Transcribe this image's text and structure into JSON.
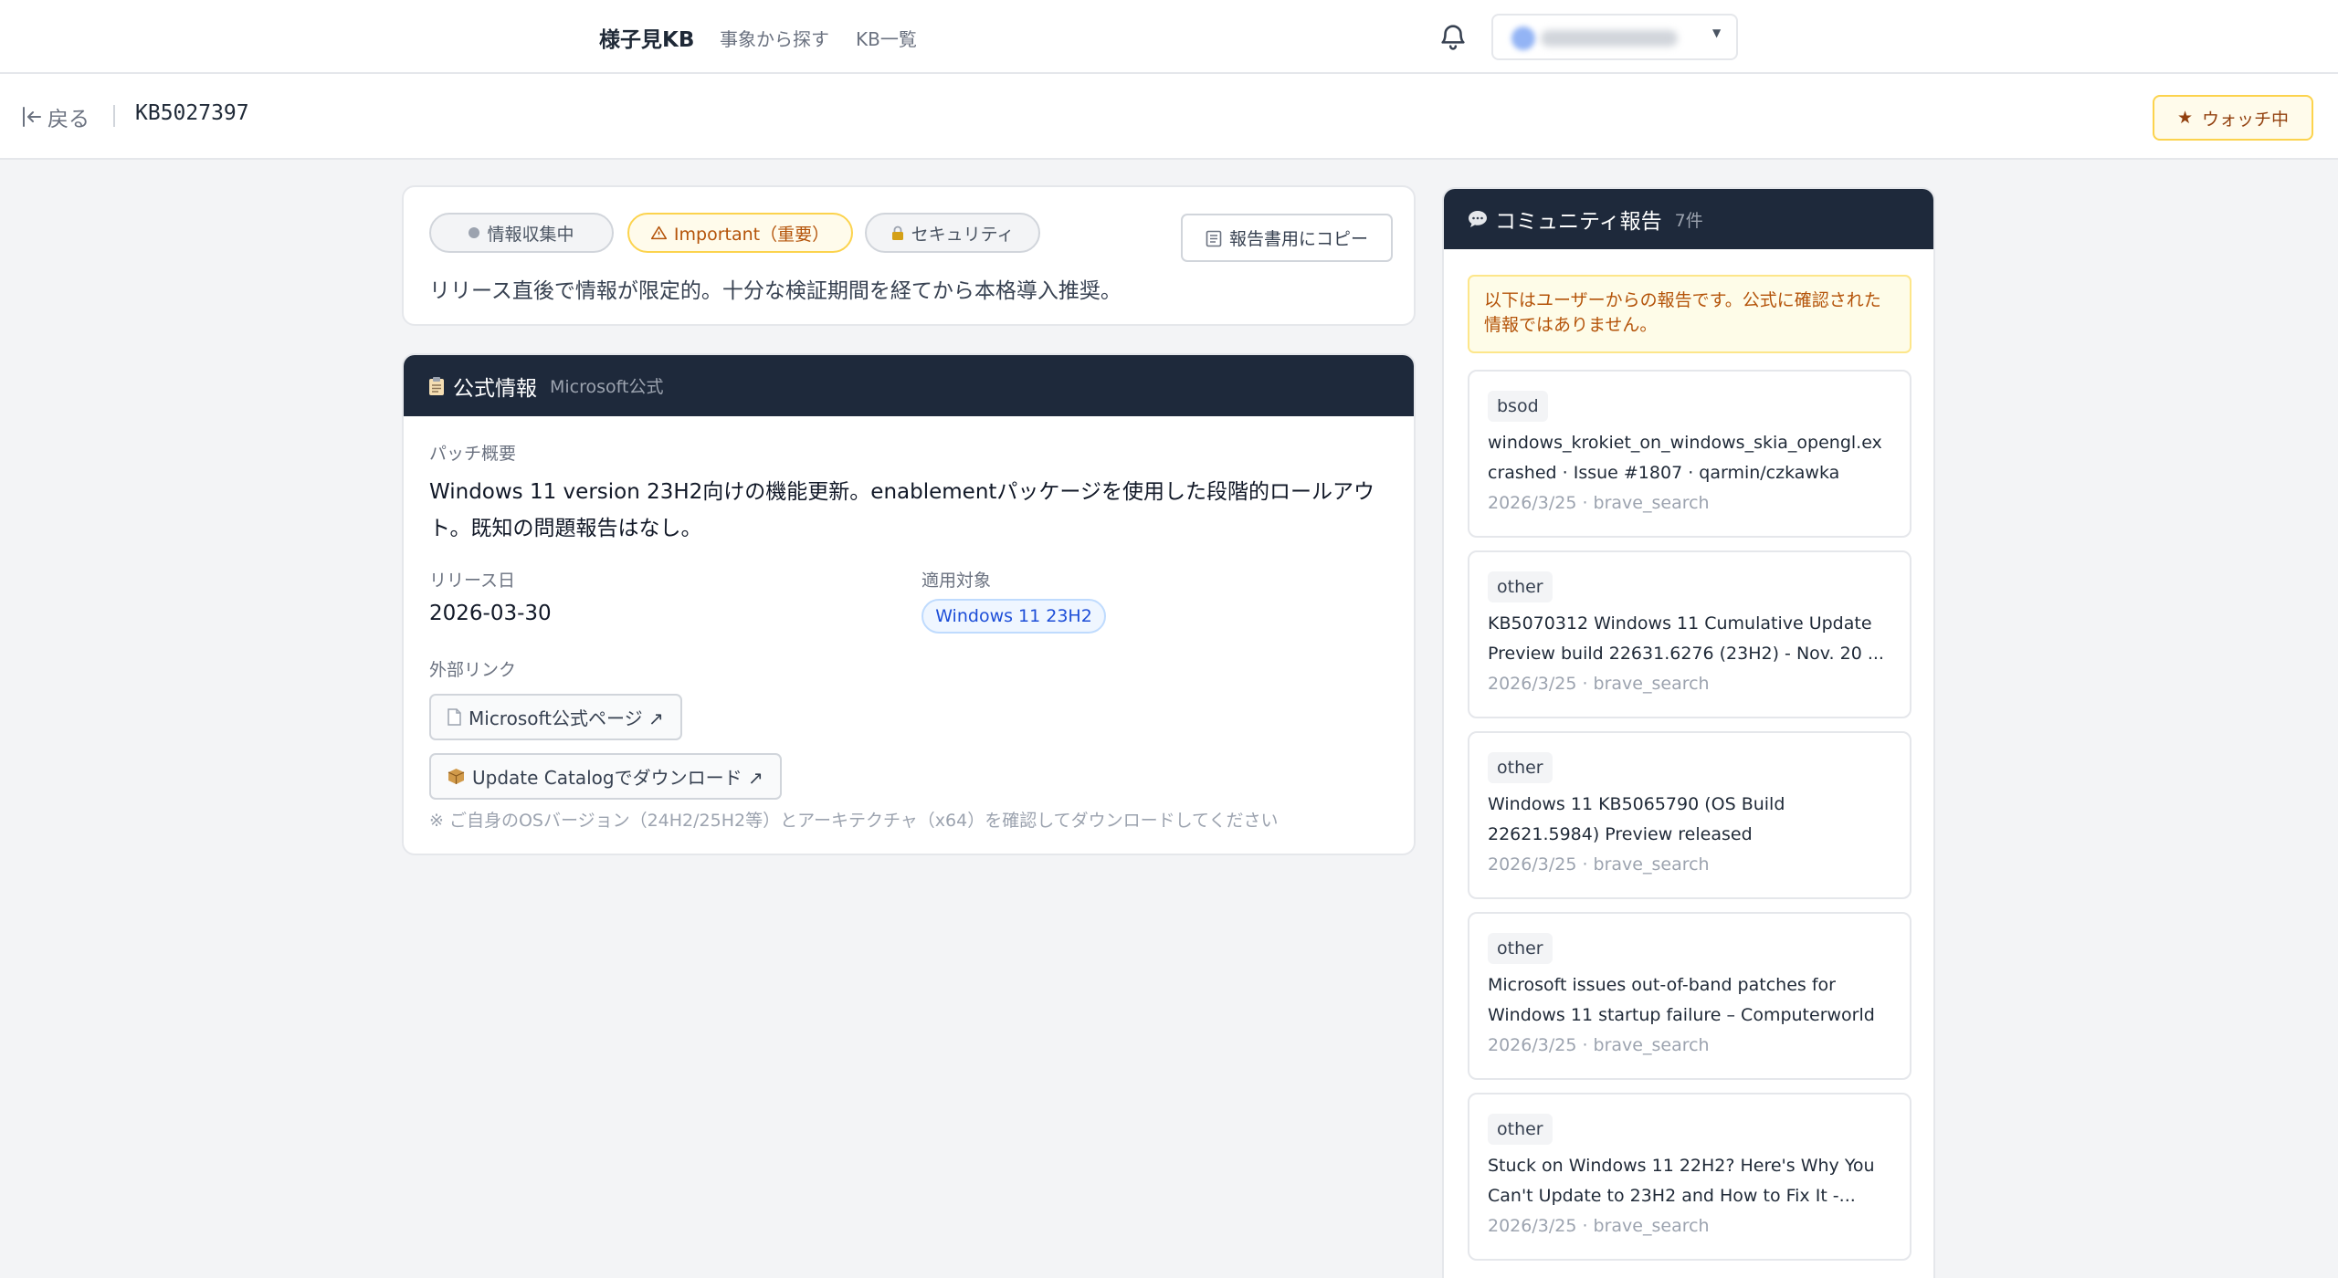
{
  "nav": {
    "brand": "様子見KB",
    "links": [
      "事象から探す",
      "KB一覧"
    ]
  },
  "subheader": {
    "back_label": "戻る",
    "kb_id": "KB5027397",
    "watch_label": "ウォッチ中"
  },
  "status": {
    "pills": [
      "情報収集中",
      "Important（重要）",
      "セキュリティ"
    ],
    "copy_label": "報告書用にコピー",
    "note": "リリース直後で情報が限定的。十分な検証期間を経てから本格導入推奨。"
  },
  "official": {
    "title": "公式情報",
    "subtitle": "Microsoft公式",
    "summary_label": "パッチ概要",
    "summary": "Windows 11 version 23H2向けの機能更新。enablementパッケージを使用した段階的ロールアウト。既知の問題報告はなし。",
    "release_label": "リリース日",
    "release_date": "2026-03-30",
    "target_label": "適用対象",
    "target": "Windows 11 23H2",
    "links_label": "外部リンク",
    "links": [
      "Microsoft公式ページ ↗",
      "Update Catalogでダウンロード ↗"
    ],
    "hint": "※ ご自身のOSバージョン（24H2/25H2等）とアーキテクチャ（x64）を確認してダウンロードしてください"
  },
  "community": {
    "title": "コミュニティ報告",
    "count": "7件",
    "warning": "以下はユーザーからの報告です。公式に確認された情報ではありません。",
    "reports": [
      {
        "tag": "bsod",
        "title": "windows_krokiet_on_windows_skia_opengl.ex crashed · Issue #1807 · qarmin/czkawka",
        "meta": "2026/3/25 · brave_search"
      },
      {
        "tag": "other",
        "title": "KB5070312 Windows 11 Cumulative Update Preview build 22631.6276 (23H2) - Nov. 20 ...",
        "meta": "2026/3/25 · brave_search"
      },
      {
        "tag": "other",
        "title": "Windows 11 KB5065790 (OS Build 22621.5984) Preview released",
        "meta": "2026/3/25 · brave_search"
      },
      {
        "tag": "other",
        "title": "Microsoft issues out-of-band patches for Windows 11 startup failure – Computerworld",
        "meta": "2026/3/25 · brave_search"
      },
      {
        "tag": "other",
        "title": "Stuck on Windows 11 22H2? Here's Why You Can't Update to 23H2 and How to Fix It -...",
        "meta": "2026/3/25 · brave_search"
      }
    ]
  }
}
